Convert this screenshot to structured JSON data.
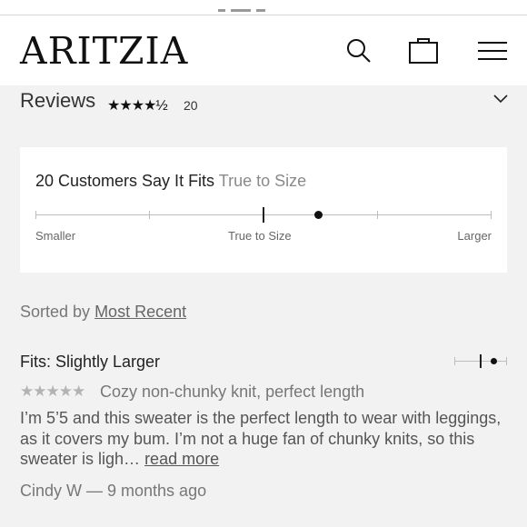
{
  "header": {
    "logo": "ARITZIA",
    "icons": [
      "search-icon",
      "shopping-bag-icon",
      "menu-icon"
    ]
  },
  "reviews": {
    "title": "Reviews",
    "rating_stars": "★★★★½",
    "rating": 4.5,
    "count": "20"
  },
  "fit_summary": {
    "heading": "20 Customers Say It Fits",
    "verdict": "True to Size",
    "scale_labels": {
      "left": "Smaller",
      "center": "True to Size",
      "right": "Larger"
    },
    "fit_position": 0.62
  },
  "sort": {
    "prefix": "Sorted by",
    "value": "Most Recent"
  },
  "review": {
    "fit": "Fits: Slightly Larger",
    "stars": "★★★★★",
    "title": "Cozy non-chunky knit, perfect length",
    "body": "I’m 5’5 and this sweater is the perfect length to wear with leggings, as it covers my bum. I’m not a huge fan of chunky knits, so this sweater is ligh…",
    "read_more": "read more",
    "author": "Cindy W — 9 months ago"
  },
  "colors": {
    "background": "#f2f2f2",
    "card": "#ffffff",
    "text": "#222222",
    "muted": "#8a8a8a"
  }
}
